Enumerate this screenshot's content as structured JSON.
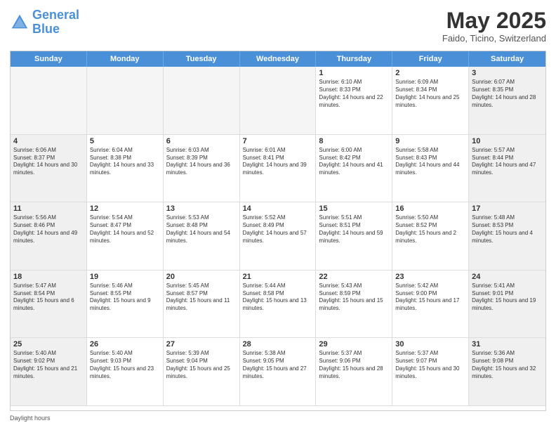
{
  "header": {
    "logo_line1": "General",
    "logo_line2": "Blue",
    "month": "May 2025",
    "location": "Faido, Ticino, Switzerland"
  },
  "weekdays": [
    "Sunday",
    "Monday",
    "Tuesday",
    "Wednesday",
    "Thursday",
    "Friday",
    "Saturday"
  ],
  "weeks": [
    [
      {
        "day": "",
        "empty": true
      },
      {
        "day": "",
        "empty": true
      },
      {
        "day": "",
        "empty": true
      },
      {
        "day": "",
        "empty": true
      },
      {
        "day": "1",
        "sunrise": "Sunrise: 6:10 AM",
        "sunset": "Sunset: 8:33 PM",
        "daylight": "Daylight: 14 hours and 22 minutes."
      },
      {
        "day": "2",
        "sunrise": "Sunrise: 6:09 AM",
        "sunset": "Sunset: 8:34 PM",
        "daylight": "Daylight: 14 hours and 25 minutes."
      },
      {
        "day": "3",
        "shaded": true,
        "sunrise": "Sunrise: 6:07 AM",
        "sunset": "Sunset: 8:35 PM",
        "daylight": "Daylight: 14 hours and 28 minutes."
      }
    ],
    [
      {
        "day": "4",
        "shaded": true,
        "sunrise": "Sunrise: 6:06 AM",
        "sunset": "Sunset: 8:37 PM",
        "daylight": "Daylight: 14 hours and 30 minutes."
      },
      {
        "day": "5",
        "sunrise": "Sunrise: 6:04 AM",
        "sunset": "Sunset: 8:38 PM",
        "daylight": "Daylight: 14 hours and 33 minutes."
      },
      {
        "day": "6",
        "sunrise": "Sunrise: 6:03 AM",
        "sunset": "Sunset: 8:39 PM",
        "daylight": "Daylight: 14 hours and 36 minutes."
      },
      {
        "day": "7",
        "sunrise": "Sunrise: 6:01 AM",
        "sunset": "Sunset: 8:41 PM",
        "daylight": "Daylight: 14 hours and 39 minutes."
      },
      {
        "day": "8",
        "sunrise": "Sunrise: 6:00 AM",
        "sunset": "Sunset: 8:42 PM",
        "daylight": "Daylight: 14 hours and 41 minutes."
      },
      {
        "day": "9",
        "sunrise": "Sunrise: 5:58 AM",
        "sunset": "Sunset: 8:43 PM",
        "daylight": "Daylight: 14 hours and 44 minutes."
      },
      {
        "day": "10",
        "shaded": true,
        "sunrise": "Sunrise: 5:57 AM",
        "sunset": "Sunset: 8:44 PM",
        "daylight": "Daylight: 14 hours and 47 minutes."
      }
    ],
    [
      {
        "day": "11",
        "shaded": true,
        "sunrise": "Sunrise: 5:56 AM",
        "sunset": "Sunset: 8:46 PM",
        "daylight": "Daylight: 14 hours and 49 minutes."
      },
      {
        "day": "12",
        "sunrise": "Sunrise: 5:54 AM",
        "sunset": "Sunset: 8:47 PM",
        "daylight": "Daylight: 14 hours and 52 minutes."
      },
      {
        "day": "13",
        "sunrise": "Sunrise: 5:53 AM",
        "sunset": "Sunset: 8:48 PM",
        "daylight": "Daylight: 14 hours and 54 minutes."
      },
      {
        "day": "14",
        "sunrise": "Sunrise: 5:52 AM",
        "sunset": "Sunset: 8:49 PM",
        "daylight": "Daylight: 14 hours and 57 minutes."
      },
      {
        "day": "15",
        "sunrise": "Sunrise: 5:51 AM",
        "sunset": "Sunset: 8:51 PM",
        "daylight": "Daylight: 14 hours and 59 minutes."
      },
      {
        "day": "16",
        "sunrise": "Sunrise: 5:50 AM",
        "sunset": "Sunset: 8:52 PM",
        "daylight": "Daylight: 15 hours and 2 minutes."
      },
      {
        "day": "17",
        "shaded": true,
        "sunrise": "Sunrise: 5:48 AM",
        "sunset": "Sunset: 8:53 PM",
        "daylight": "Daylight: 15 hours and 4 minutes."
      }
    ],
    [
      {
        "day": "18",
        "shaded": true,
        "sunrise": "Sunrise: 5:47 AM",
        "sunset": "Sunset: 8:54 PM",
        "daylight": "Daylight: 15 hours and 6 minutes."
      },
      {
        "day": "19",
        "sunrise": "Sunrise: 5:46 AM",
        "sunset": "Sunset: 8:55 PM",
        "daylight": "Daylight: 15 hours and 9 minutes."
      },
      {
        "day": "20",
        "sunrise": "Sunrise: 5:45 AM",
        "sunset": "Sunset: 8:57 PM",
        "daylight": "Daylight: 15 hours and 11 minutes."
      },
      {
        "day": "21",
        "sunrise": "Sunrise: 5:44 AM",
        "sunset": "Sunset: 8:58 PM",
        "daylight": "Daylight: 15 hours and 13 minutes."
      },
      {
        "day": "22",
        "sunrise": "Sunrise: 5:43 AM",
        "sunset": "Sunset: 8:59 PM",
        "daylight": "Daylight: 15 hours and 15 minutes."
      },
      {
        "day": "23",
        "sunrise": "Sunrise: 5:42 AM",
        "sunset": "Sunset: 9:00 PM",
        "daylight": "Daylight: 15 hours and 17 minutes."
      },
      {
        "day": "24",
        "shaded": true,
        "sunrise": "Sunrise: 5:41 AM",
        "sunset": "Sunset: 9:01 PM",
        "daylight": "Daylight: 15 hours and 19 minutes."
      }
    ],
    [
      {
        "day": "25",
        "shaded": true,
        "sunrise": "Sunrise: 5:40 AM",
        "sunset": "Sunset: 9:02 PM",
        "daylight": "Daylight: 15 hours and 21 minutes."
      },
      {
        "day": "26",
        "sunrise": "Sunrise: 5:40 AM",
        "sunset": "Sunset: 9:03 PM",
        "daylight": "Daylight: 15 hours and 23 minutes."
      },
      {
        "day": "27",
        "sunrise": "Sunrise: 5:39 AM",
        "sunset": "Sunset: 9:04 PM",
        "daylight": "Daylight: 15 hours and 25 minutes."
      },
      {
        "day": "28",
        "sunrise": "Sunrise: 5:38 AM",
        "sunset": "Sunset: 9:05 PM",
        "daylight": "Daylight: 15 hours and 27 minutes."
      },
      {
        "day": "29",
        "sunrise": "Sunrise: 5:37 AM",
        "sunset": "Sunset: 9:06 PM",
        "daylight": "Daylight: 15 hours and 28 minutes."
      },
      {
        "day": "30",
        "sunrise": "Sunrise: 5:37 AM",
        "sunset": "Sunset: 9:07 PM",
        "daylight": "Daylight: 15 hours and 30 minutes."
      },
      {
        "day": "31",
        "shaded": true,
        "sunrise": "Sunrise: 5:36 AM",
        "sunset": "Sunset: 9:08 PM",
        "daylight": "Daylight: 15 hours and 32 minutes."
      }
    ]
  ],
  "footer": "Daylight hours"
}
